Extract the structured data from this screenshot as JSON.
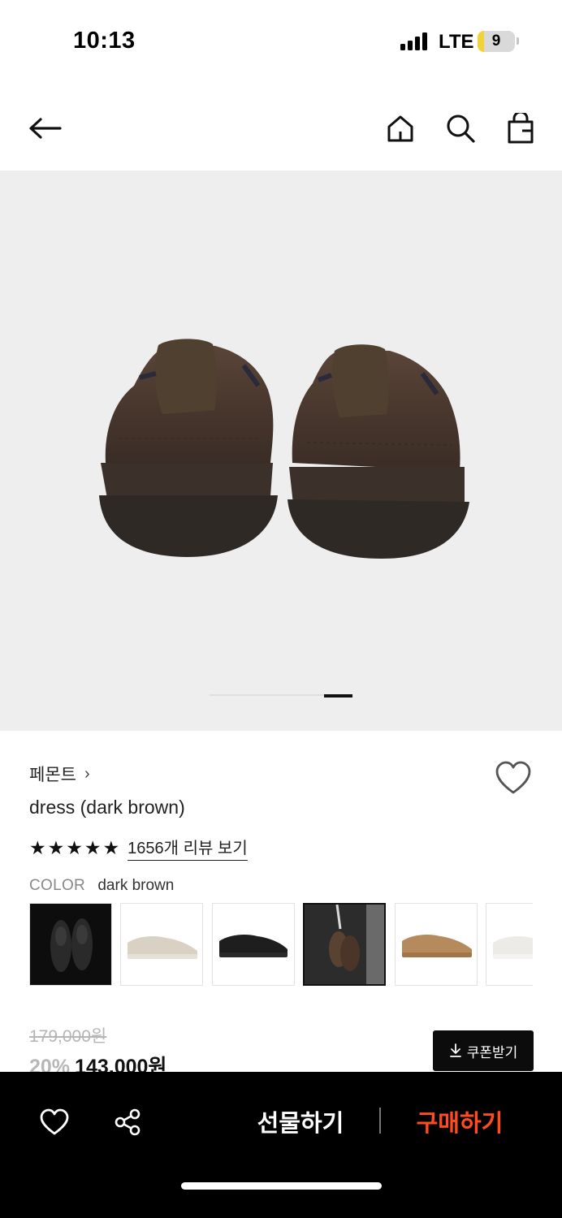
{
  "status_bar": {
    "time": "10:13",
    "network": "LTE",
    "battery_level": "9",
    "battery_color": "#f2d23a"
  },
  "top_nav": {
    "icons": [
      "back-arrow-icon",
      "home-icon",
      "search-icon",
      "shopping-bag-icon"
    ]
  },
  "gallery": {
    "image_description_icon": "suede-sneakers-rear-view",
    "background": "#eeeeee",
    "current_slide_fraction": 0.8
  },
  "product": {
    "brand": "페몬트",
    "brand_chevron": "›",
    "name": "dress (dark brown)",
    "rating_stars": 5,
    "review_link": "1656개 리뷰 보기",
    "color_label": "COLOR",
    "color_value": "dark brown",
    "swatches": [
      {
        "variant": "black-leather-dark-bg",
        "selected": false
      },
      {
        "variant": "beige",
        "selected": false
      },
      {
        "variant": "black",
        "selected": false
      },
      {
        "variant": "dark-brown-held",
        "selected": true
      },
      {
        "variant": "tan",
        "selected": false
      },
      {
        "variant": "white",
        "selected": false
      }
    ],
    "original_price": "179,000원",
    "discount": "20%",
    "price": "143,000원",
    "coupon_button": "쿠폰받기"
  },
  "bottom_bar": {
    "gift_button": "선물하기",
    "buy_button": "구매하기",
    "buy_color": "#ff4b1f"
  }
}
